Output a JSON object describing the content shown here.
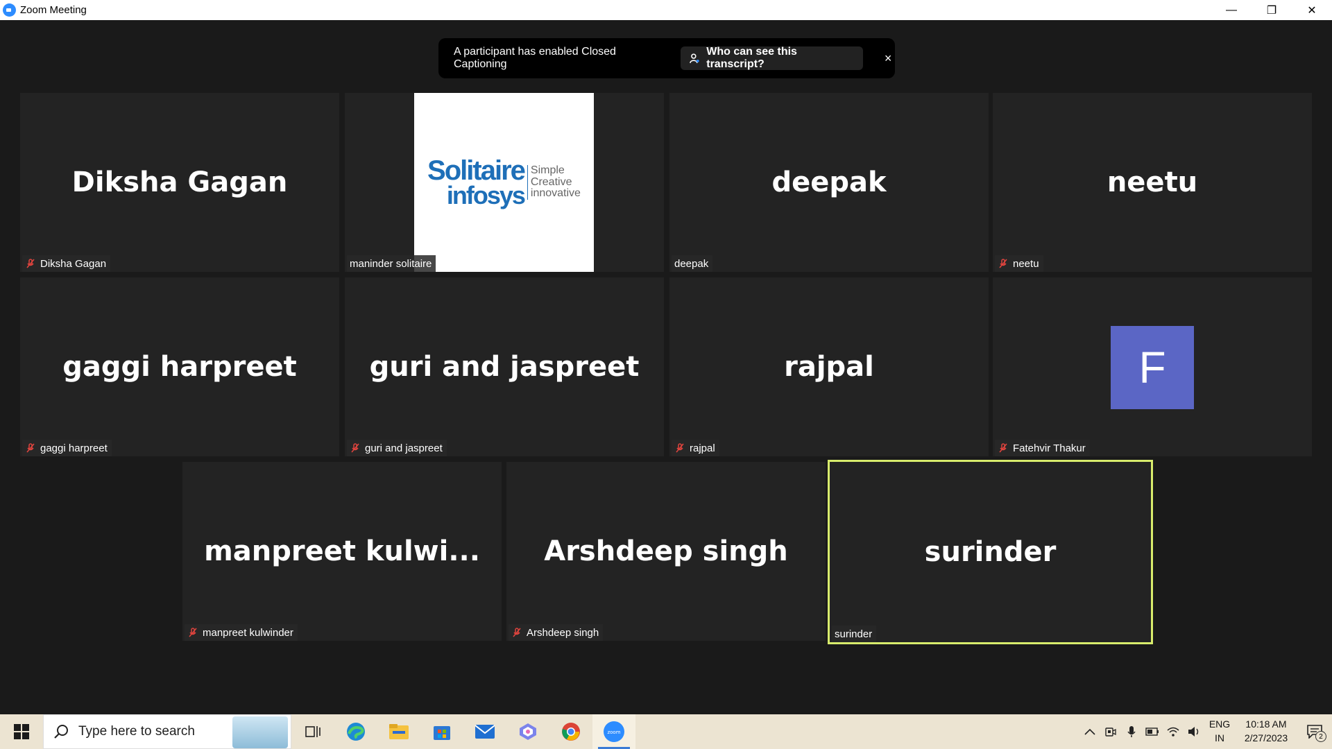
{
  "window": {
    "title": "Zoom Meeting",
    "controls": {
      "minimize": "—",
      "restore": "❐",
      "close": "✕"
    }
  },
  "banner": {
    "text": "A participant has enabled Closed Captioning",
    "button": "Who can see this transcript?",
    "close": "×"
  },
  "participants": [
    {
      "display": "Diksha Gagan",
      "label": "Diksha Gagan",
      "muted": true
    },
    {
      "display": "",
      "label": "maninder solitaire",
      "muted": false,
      "logo": {
        "line1": "Solitaire",
        "line2": "infosys",
        "side1": "Simple",
        "side2": "Creative",
        "side3": "innovative"
      }
    },
    {
      "display": "deepak",
      "label": "deepak",
      "muted": false
    },
    {
      "display": "neetu",
      "label": "neetu",
      "muted": true
    },
    {
      "display": "gaggi harpreet",
      "label": "gaggi harpreet",
      "muted": true
    },
    {
      "display": "guri and jaspreet",
      "label": "guri and jaspreet",
      "muted": true
    },
    {
      "display": "rajpal",
      "label": "rajpal",
      "muted": true
    },
    {
      "display": "",
      "label": "Fatehvir Thakur",
      "muted": true,
      "avatar": "F"
    },
    {
      "display": "manpreet  kulwi...",
      "label": "manpreet kulwinder",
      "muted": true
    },
    {
      "display": "Arshdeep singh",
      "label": "Arshdeep singh",
      "muted": true
    },
    {
      "display": "surinder",
      "label": "surinder",
      "muted": false,
      "active_speaker": true
    }
  ],
  "taskbar": {
    "search_placeholder": "Type here to search",
    "apps": [
      "task-view-icon",
      "edge-icon",
      "file-explorer-icon",
      "store-icon",
      "mail-icon",
      "teams-icon",
      "chrome-icon",
      "zoom-icon"
    ],
    "active_app": "zoom-icon",
    "tray": {
      "language_line1": "ENG",
      "language_line2": "IN",
      "time": "10:18 AM",
      "date": "2/27/2023",
      "notification_count": "2"
    }
  },
  "colors": {
    "meeting_bg": "#1a1a1a",
    "tile_bg": "#232323",
    "active_speaker_border": "#d8ec6c",
    "avatar_bg": "#5b66c5",
    "mute_red": "#e0443e",
    "zoom_blue": "#2d8cff"
  }
}
